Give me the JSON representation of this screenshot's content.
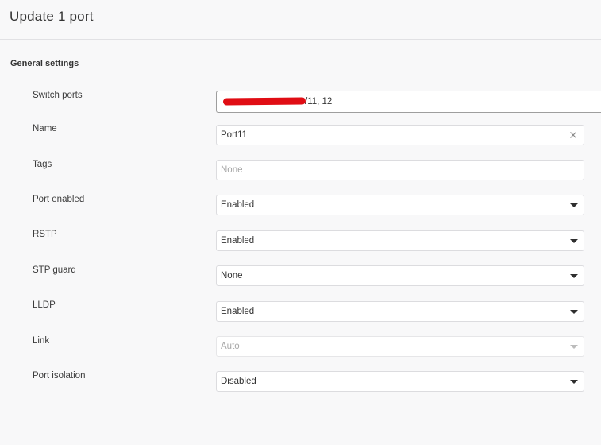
{
  "header": {
    "title": "Update 1 port"
  },
  "section": {
    "title": "General settings"
  },
  "fields": {
    "switch_ports": {
      "label": "Switch ports",
      "value_suffix": "/11, 12"
    },
    "name": {
      "label": "Name",
      "value": "Port11"
    },
    "tags": {
      "label": "Tags",
      "placeholder": "None"
    },
    "port_enabled": {
      "label": "Port enabled",
      "value": "Enabled"
    },
    "rstp": {
      "label": "RSTP",
      "value": "Enabled"
    },
    "stp_guard": {
      "label": "STP guard",
      "value": "None"
    },
    "lldp": {
      "label": "LLDP",
      "value": "Enabled"
    },
    "link": {
      "label": "Link",
      "value": "Auto"
    },
    "port_isolation": {
      "label": "Port isolation",
      "value": "Disabled"
    }
  },
  "icons": {
    "clear": "close-icon",
    "dropdown": "caret-down-icon"
  },
  "colors": {
    "background": "#f8f8f9",
    "field_background": "#ffffff",
    "redaction": "#e00d14"
  }
}
